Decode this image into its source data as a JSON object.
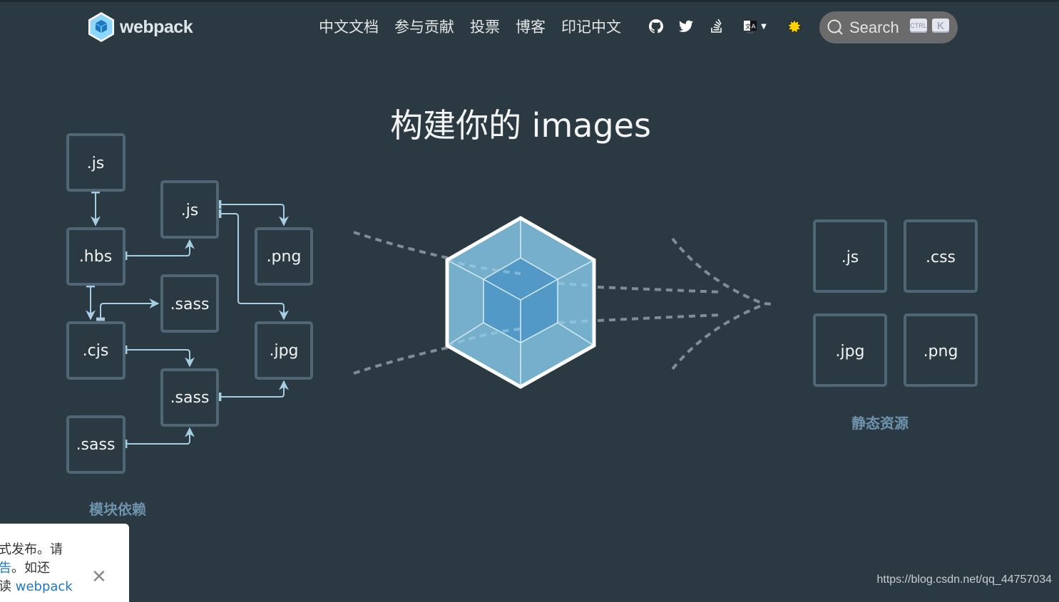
{
  "header": {
    "logo_text": "webpack",
    "nav": [
      "中文文档",
      "参与贡献",
      "投票",
      "博客",
      "印记中文"
    ],
    "icons": [
      "github-icon",
      "twitter-icon",
      "stack-overflow-icon",
      "language-icon",
      "theme-sun-icon"
    ],
    "search": {
      "label": "Search",
      "shortcut_keys": [
        "CTRL",
        "K"
      ]
    }
  },
  "hero": {
    "title": "构建你的 images",
    "dependency_modules": [
      ".js",
      ".hbs",
      ".js",
      ".png",
      ".sass",
      ".cjs",
      ".jpg",
      ".sass",
      ".sass"
    ],
    "dependency_caption": "模块依赖",
    "static_assets": [
      ".js",
      ".css",
      ".jpg",
      ".png"
    ],
    "assets_caption": "静态资源"
  },
  "toast": {
    "line1": "式发布。请",
    "line2_link": "告",
    "line2_rest": "。如还",
    "line3_prefix": "读 ",
    "line3_link": "webpack",
    "close_label": "✕"
  },
  "watermark": "https://blog.csdn.net/qq_44757034",
  "colors": {
    "background": "#2b3a42",
    "box_border": "#4f6674",
    "arrow": "#a7cde3",
    "cube_outer": "#75afcc",
    "cube_inner": "#5299c8",
    "caption": "#6f93ad"
  }
}
